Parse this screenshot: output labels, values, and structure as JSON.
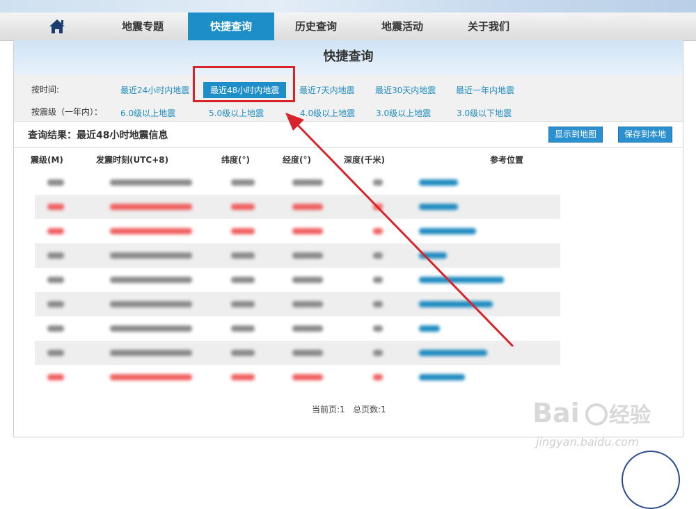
{
  "nav": {
    "home_icon": "home-icon",
    "items": [
      {
        "label": "地震专题"
      },
      {
        "label": "快捷查询"
      },
      {
        "label": "历史查询"
      },
      {
        "label": "地震活动"
      },
      {
        "label": "关于我们"
      }
    ],
    "active_index": 1
  },
  "query": {
    "title": "快捷查询",
    "time_label": "按时间:",
    "time_options": [
      "最近24小时内地震",
      "最近48小时内地震",
      "最近7天内地震",
      "最近30天内地震",
      "最近一年内地震"
    ],
    "time_selected": 1,
    "mag_label": "按震级（一年内）：",
    "mag_options": [
      "6.0级以上地震",
      "5.0级以上地震",
      "4.0级以上地震",
      "3.0级以上地震",
      "3.0级以下地震"
    ]
  },
  "results": {
    "title": "查询结果：最近48小时地震信息",
    "show_map_button": "显示到地图",
    "save_button": "保存到本地",
    "columns": [
      "震级(M)",
      "发震时刻(UTC+8)",
      "纬度(°)",
      "经度(°)",
      "深度(千米)",
      "参考位置"
    ],
    "row_count": 9,
    "row_highlight": [
      "normal",
      "red",
      "red",
      "normal",
      "normal",
      "normal",
      "normal",
      "normal",
      "red"
    ]
  },
  "pagination": {
    "current_label": "当前页:1",
    "total_label": "总页数:1"
  },
  "watermark": {
    "brand": "Bai du 经验",
    "url": "jingyan.baidu.com"
  },
  "colors": {
    "accent": "#1e8ec8",
    "link": "#1f8bc0",
    "highlight_box": "#d8232a",
    "red_row_text": "#f06060"
  }
}
